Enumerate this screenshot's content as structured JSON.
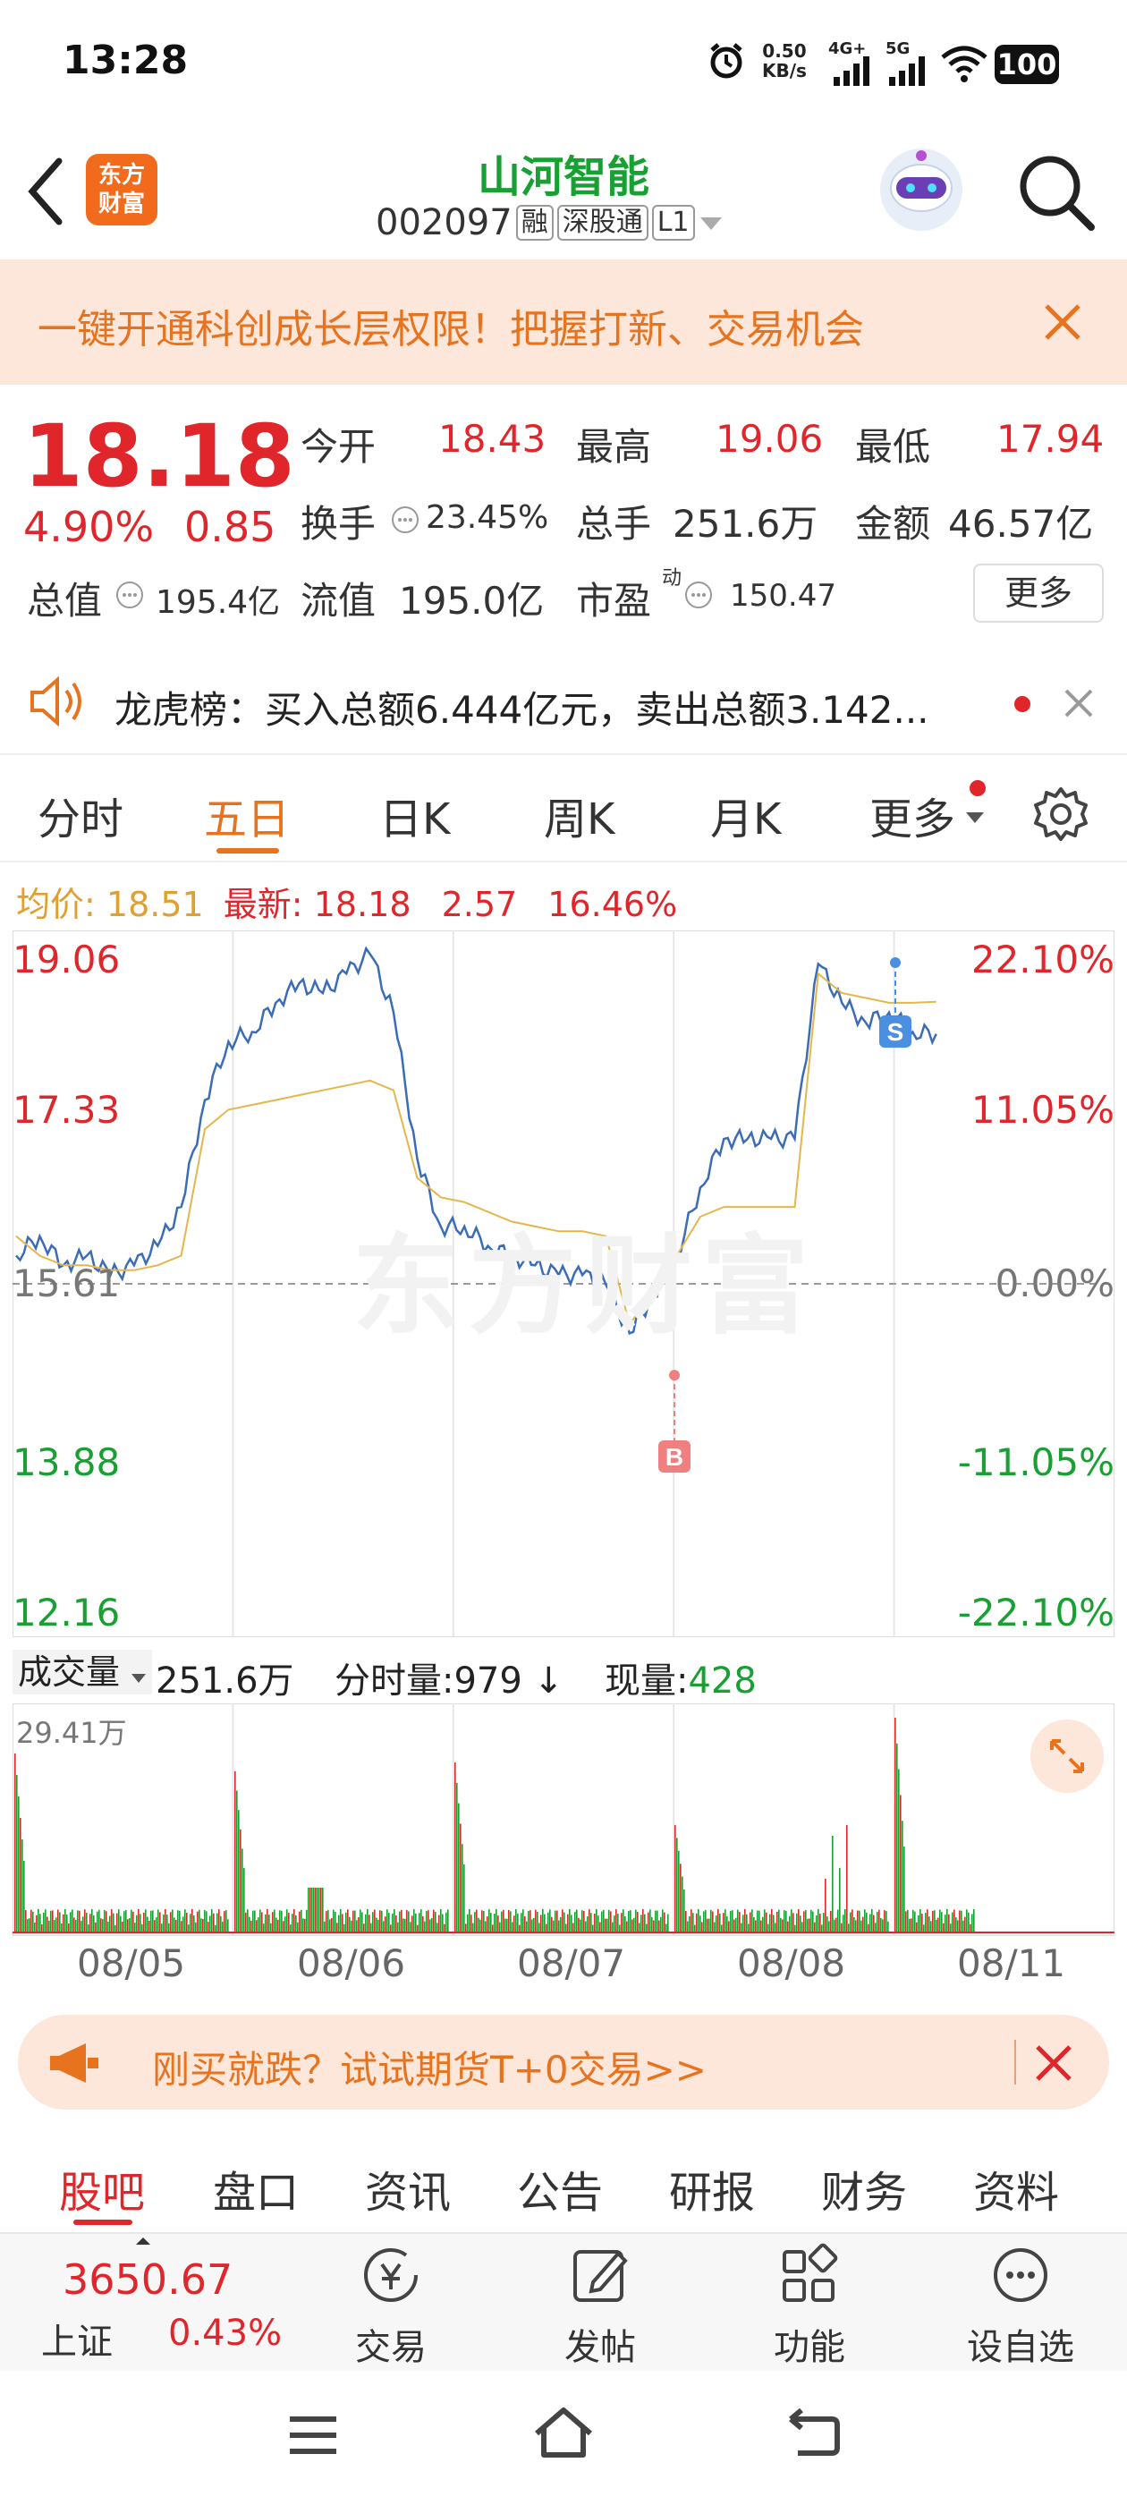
{
  "status_bar": {
    "time": "13:28",
    "speed_value": "0.50",
    "speed_unit": "KB/s",
    "net1": "4G+",
    "net2": "5G",
    "battery": "100"
  },
  "header": {
    "logo_line1": "东方",
    "logo_line2": "财富",
    "title": "山河智能",
    "code": "002097",
    "tag_margin": "融",
    "tag_connect": "深股通",
    "tag_level": "L1"
  },
  "promo": {
    "text": "一键开通科创成长层权限！把握打新、交易机会"
  },
  "quote": {
    "price": "18.18",
    "change_pct": "4.90%",
    "change_amt": "0.85",
    "open_label": "今开",
    "open": "18.43",
    "high_label": "最高",
    "high": "19.06",
    "low_label": "最低",
    "low": "17.94",
    "turnover_label": "换手",
    "turnover": "23.45%",
    "volume_label": "总手",
    "volume": "251.6万",
    "amount_label": "金额",
    "amount": "46.57亿",
    "mktcap_label": "总值",
    "mktcap": "195.4亿",
    "float_label": "流值",
    "float": "195.0亿",
    "pe_label": "市盈",
    "pe_sup": "动",
    "pe": "150.47",
    "more_button": "更多"
  },
  "notice": {
    "text": "龙虎榜：买入总额6.444亿元，卖出总额3.142..."
  },
  "chart_tabs": [
    "分时",
    "五日",
    "日K",
    "周K",
    "月K",
    "更多"
  ],
  "active_chart_tab": 1,
  "info_line": {
    "avg_label": "均价:",
    "avg": "18.51",
    "last_label": "最新:",
    "last": "18.18",
    "v1": "2.57",
    "v2": "16.46%"
  },
  "chart_data": {
    "type": "line",
    "title": "",
    "y_left_ticks": [
      "19.06",
      "17.33",
      "15.61",
      "13.88",
      "12.16"
    ],
    "y_right_ticks": [
      "22.10%",
      "11.05%",
      "0.00%",
      "-11.05%",
      "-22.10%"
    ],
    "ylim": [
      12.16,
      19.06
    ],
    "base_price": 15.61,
    "days": [
      "08/05",
      "08/06",
      "08/07",
      "08/08",
      "08/11"
    ],
    "series": [
      {
        "values": [
          15.9,
          16.1,
          15.8,
          15.9,
          15.7,
          15.8,
          16.0,
          16.4,
          17.5,
          18.1,
          18.2,
          18.5,
          18.7,
          18.6,
          18.8,
          19.0,
          18.4,
          16.9,
          16.2,
          16.2,
          16.0,
          15.9,
          15.8,
          15.7,
          15.7,
          15.6,
          15.1,
          15.5,
          15.9,
          16.6,
          17.1,
          17.1,
          17.1,
          17.1,
          18.9,
          18.5,
          18.3,
          18.4,
          18.2,
          18.18
        ],
        "color": "#3b6cb7"
      },
      {
        "values": [
          16.1,
          15.9,
          15.8,
          15.8,
          15.75,
          15.75,
          15.8,
          15.9,
          17.2,
          17.4,
          17.45,
          17.5,
          17.55,
          17.6,
          17.65,
          17.7,
          17.6,
          16.7,
          16.5,
          16.45,
          16.35,
          16.25,
          16.2,
          16.15,
          16.15,
          16.1,
          15.2,
          15.5,
          15.9,
          16.3,
          16.4,
          16.4,
          16.4,
          16.4,
          18.8,
          18.6,
          18.55,
          18.5,
          18.5,
          18.51
        ],
        "color": "#e5b64c"
      }
    ],
    "markers": [
      {
        "label": "B",
        "price": 14.67
      },
      {
        "label": "S",
        "price": 17.7
      }
    ]
  },
  "volume_bar": {
    "label": "成交量",
    "total": "251.6万",
    "tick_label": "分时量:979",
    "arrow": "↓",
    "now_label": "现量:",
    "now": "428",
    "max": "29.41万"
  },
  "futures": {
    "text": "刚买就跌？试试期货T+0交易>>"
  },
  "bottom_tabs": [
    "股吧",
    "盘口",
    "资讯",
    "公告",
    "研报",
    "财务",
    "资料"
  ],
  "toolbar": {
    "index_value": "3650.67",
    "index_name": "上证",
    "index_pct": "0.43%",
    "trade": "交易",
    "post": "发帖",
    "func": "功能",
    "watch": "设自选"
  },
  "watermark": "东方财富"
}
